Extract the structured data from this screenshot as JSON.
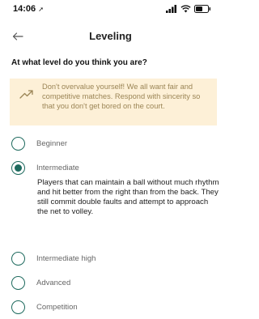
{
  "status_bar": {
    "time": "14:06"
  },
  "header": {
    "title": "Leveling"
  },
  "question": "At what level do you think you are?",
  "notice": {
    "text": "Don't overvalue yourself! We all want fair and competitive matches. Respond with sincerity so that you don't get bored on the court."
  },
  "levels": [
    {
      "label": "Beginner",
      "selected": false
    },
    {
      "label": "Intermediate",
      "selected": true
    },
    {
      "label": "Intermediate high",
      "selected": false
    },
    {
      "label": "Advanced",
      "selected": false
    },
    {
      "label": "Competition",
      "selected": false
    }
  ],
  "selected_description": "Players that can maintain a ball without much rhythm and hit better from the right than from the back. They still commit double faults and attempt to approach the net to volley.",
  "colors": {
    "accent": "#1e6a5e",
    "notice_bg": "#fdf0d7",
    "notice_text": "#9b8556"
  }
}
